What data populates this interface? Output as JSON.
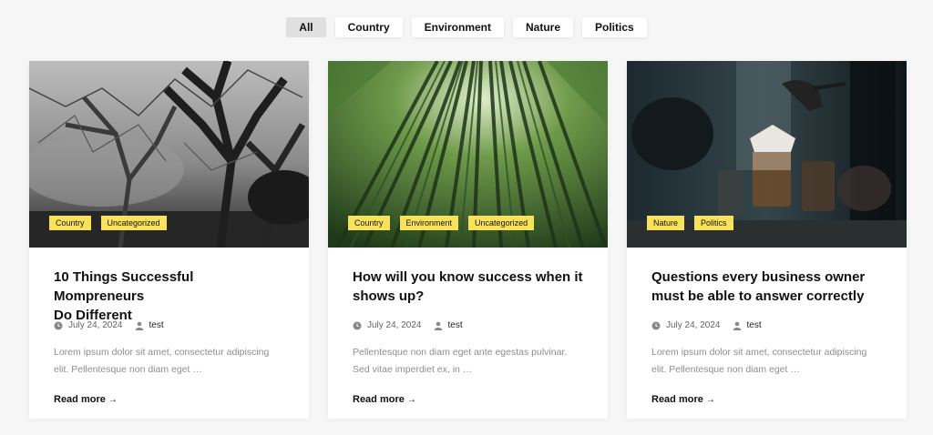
{
  "filters": [
    {
      "label": "All",
      "active": true
    },
    {
      "label": "Country",
      "active": false
    },
    {
      "label": "Environment",
      "active": false
    },
    {
      "label": "Nature",
      "active": false
    },
    {
      "label": "Politics",
      "active": false
    }
  ],
  "colors": {
    "background": "#f6f6f7",
    "card": "#ffffff",
    "tag": "#f7e25a",
    "excerpt_text": "#8e8e8e",
    "active_filter": "#e0e0e0"
  },
  "posts": [
    {
      "image": "black-and-white-forest-trees-photo",
      "tags": [
        "Country",
        "Uncategorized"
      ],
      "title_line1": "10 Things Successful Mompreneurs",
      "title_line2": "Do Different",
      "date": "July 24, 2024",
      "author": "test",
      "excerpt_line1": "Lorem ipsum dolor sit amet, consectetur adipiscing",
      "excerpt_line2": "elit. Pellentesque non diam eget …",
      "read_more": "Read more",
      "arrow": "→"
    },
    {
      "image": "bamboo-forest-looking-up-photo",
      "tags": [
        "Country",
        "Environment",
        "Uncategorized"
      ],
      "title_line1": "How will you know success when it",
      "title_line2": "shows up?",
      "date": "July 24, 2024",
      "author": "test",
      "excerpt_line1": "Pellentesque non diam eget ante egestas pulvinar.",
      "excerpt_line2": "Sed vitae imperdiet ex, in …",
      "read_more": "Read more",
      "arrow": "→"
    },
    {
      "image": "coffee-pour-over-brewing-photo",
      "tags": [
        "Nature",
        "Politics"
      ],
      "title_line1": "Questions every business owner",
      "title_line2": "must be able to answer correctly",
      "date": "July 24, 2024",
      "author": "test",
      "excerpt_line1": "Lorem ipsum dolor sit amet, consectetur adipiscing",
      "excerpt_line2": "elit. Pellentesque non diam eget …",
      "read_more": "Read more",
      "arrow": "→"
    }
  ],
  "icons": {
    "date": "clock-icon",
    "author": "user-icon"
  }
}
